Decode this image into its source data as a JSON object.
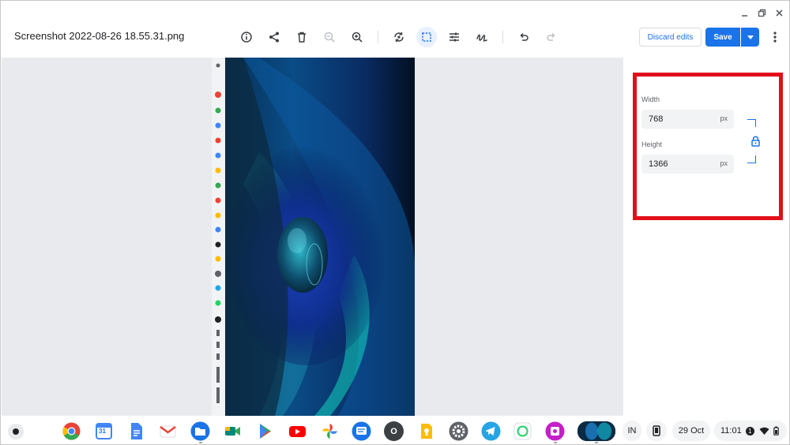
{
  "window": {
    "controls": [
      "minimize",
      "maximize",
      "close"
    ]
  },
  "header": {
    "file_name": "Screenshot 2022-08-26 18.55.31.png",
    "discard_label": "Discard edits",
    "save_label": "Save",
    "tools": [
      "info-icon",
      "share-icon",
      "delete-icon",
      "zoom-out-icon",
      "zoom-in-icon",
      "rotate-icon",
      "crop-icon",
      "adjust-icon",
      "markup-icon",
      "undo-icon",
      "redo-icon"
    ]
  },
  "resize_panel": {
    "width_label": "Width",
    "width_value": "768",
    "width_unit": "px",
    "height_label": "Height",
    "height_value": "1366",
    "height_unit": "px",
    "highlight_color": "#e0101a",
    "accent_color": "#1a73e8"
  },
  "shelf": {
    "apps": [
      "Chrome",
      "Calendar",
      "Docs",
      "Gmail",
      "Files",
      "Meet",
      "Play Store",
      "YouTube",
      "Photos",
      "Messages",
      "O",
      "Keep",
      "Settings",
      "Telegram",
      "WhatsApp",
      "Screenshot",
      "Wallpaper"
    ],
    "calendar_day": "31",
    "o_letter": "O",
    "ime": "IN",
    "date": "29 Oct",
    "time": "11:01",
    "notification_count": "1"
  }
}
